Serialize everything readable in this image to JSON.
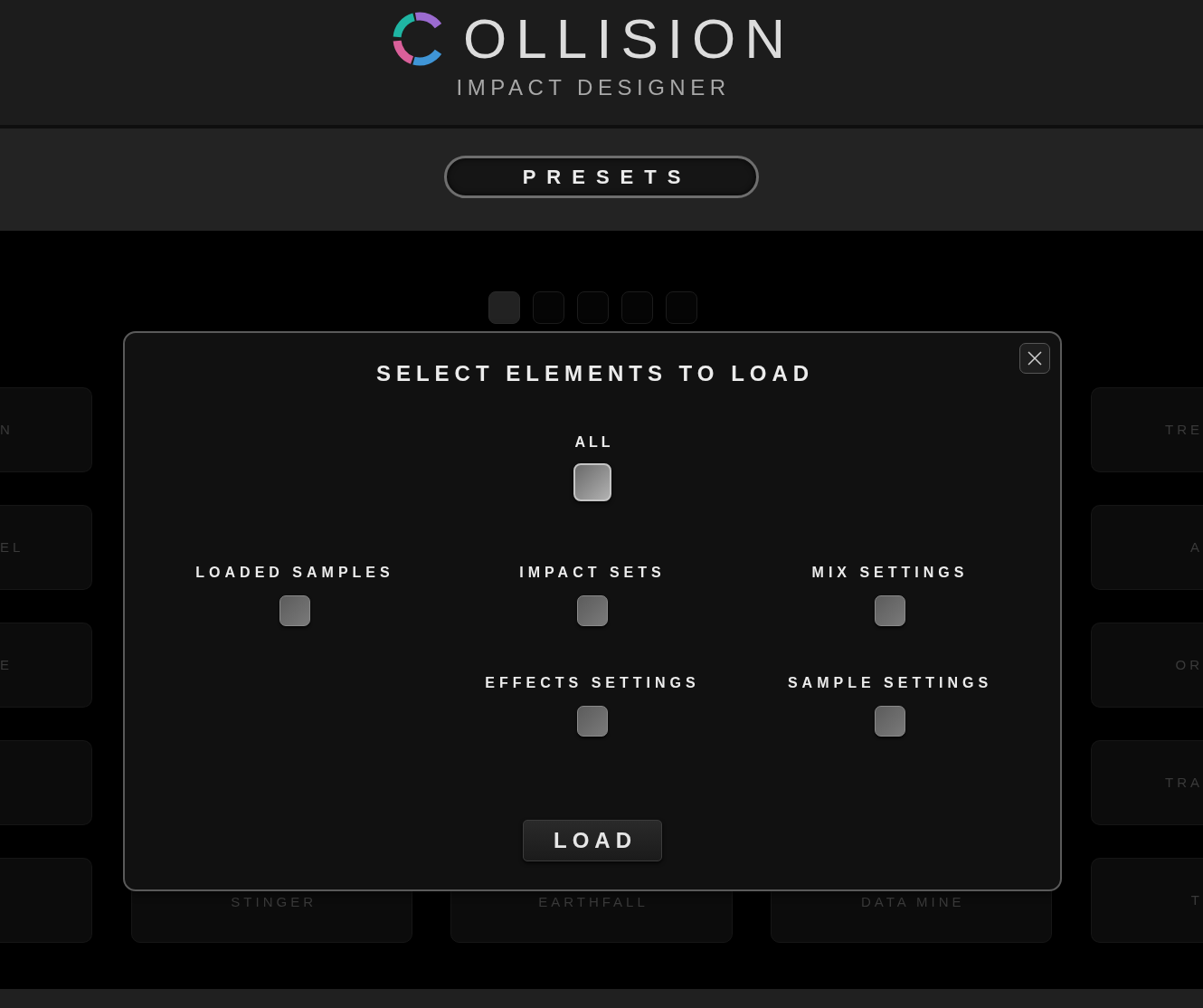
{
  "header": {
    "logo_text": "OLLISION",
    "subtitle": "IMPACT DESIGNER"
  },
  "presets_button": {
    "label": "PRESETS"
  },
  "page_dots": [
    {
      "selected": true
    },
    {
      "selected": false
    },
    {
      "selected": false
    },
    {
      "selected": false
    },
    {
      "selected": false
    }
  ],
  "preset_cards": {
    "left_column": [
      {
        "kind": "named",
        "label": "N"
      },
      {
        "kind": "named",
        "label": "EL"
      },
      {
        "kind": "named",
        "label": "E"
      },
      {
        "kind": "blank"
      },
      {
        "kind": "blank"
      }
    ],
    "bottom_row": [
      {
        "kind": "named",
        "label": "STINGER"
      },
      {
        "kind": "named",
        "label": "EARTHFALL"
      },
      {
        "kind": "named",
        "label": "DATA MINE"
      }
    ],
    "right_column": [
      {
        "kind": "named",
        "label": "TRE"
      },
      {
        "kind": "named",
        "label": "A"
      },
      {
        "kind": "named",
        "label": "OR"
      },
      {
        "kind": "named",
        "label": "TRA"
      },
      {
        "kind": "named",
        "label": "T"
      }
    ]
  },
  "dialog": {
    "title": "SELECT ELEMENTS TO LOAD",
    "all_option": {
      "label": "ALL",
      "checked": false
    },
    "option_rows": [
      [
        {
          "label": "LOADED SAMPLES",
          "checked": false
        },
        {
          "label": "IMPACT SETS",
          "checked": false
        },
        {
          "label": "MIX SETTINGS",
          "checked": false
        }
      ],
      [
        {
          "label": "EFFECTS SETTINGS",
          "checked": false
        },
        {
          "label": "SAMPLE SETTINGS",
          "checked": false
        }
      ]
    ],
    "load_button": {
      "label": "LOAD"
    }
  }
}
